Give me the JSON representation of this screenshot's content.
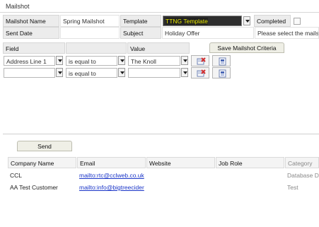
{
  "window": {
    "title": "Mailshot"
  },
  "form": {
    "name_label": "Mailshot Name",
    "name_value": "Spring Mailshot",
    "template_label": "Template",
    "template_value": "TTNG Template",
    "completed_label": "Completed",
    "sent_label": "Sent Date",
    "sent_value": "",
    "subject_label": "Subject",
    "subject_value": "Holiday Offer",
    "hint_text": "Please select the mailshot"
  },
  "criteria": {
    "field_header": "Field",
    "value_header": "Value",
    "save_label": "Save Mailshot Criteria",
    "rows": [
      {
        "field": "Address Line 1",
        "operator": "is equal to",
        "value": "The Knoll"
      },
      {
        "field": "",
        "operator": "is equal to",
        "value": ""
      }
    ]
  },
  "send": {
    "label": "Send"
  },
  "results": {
    "headers": [
      "Company Name",
      "Email",
      "Website",
      "Job Role",
      "Category"
    ],
    "rows": [
      {
        "company": "CCL",
        "email": "mailto:rtc@cclweb.co.uk",
        "website": "",
        "job_role": "",
        "category": "Database D"
      },
      {
        "company": "AA Test Customer",
        "email": "mailto:info@bigtreecider",
        "website": "",
        "job_role": "",
        "category": "Test"
      }
    ]
  },
  "icons": {
    "clear": "clear-row-icon",
    "add": "add-row-icon",
    "dropdown": "chevron-down-icon"
  },
  "colors": {
    "template_bg": "#2e2e2e",
    "template_text": "#e8e800",
    "link": "#1a35c8"
  }
}
